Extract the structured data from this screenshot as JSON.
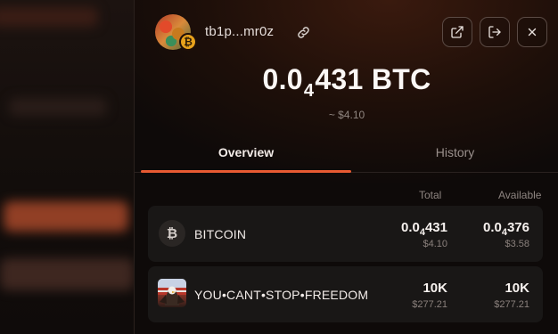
{
  "wallet": {
    "address": "tb1p...mr0z",
    "avatar_badge_symbol": "₿",
    "balance": {
      "prefix": "0.0",
      "subscript_zeros": "4",
      "digits": "431",
      "unit": "BTC",
      "fiat": "~ $4.10"
    }
  },
  "header_actions": {
    "copy_icon": "link-icon",
    "open_external_icon": "external-link-icon",
    "logout_icon": "logout-icon",
    "close_icon": "close-icon"
  },
  "tabs": [
    {
      "label": "Overview",
      "active": true
    },
    {
      "label": "History",
      "active": false
    }
  ],
  "table": {
    "columns": {
      "total": "Total",
      "available": "Available"
    },
    "rows": [
      {
        "name": "BITCOIN",
        "icon": "bitcoin-icon",
        "icon_glyph": "₿",
        "total": {
          "prefix": "0.0",
          "sub": "4",
          "digits": "431",
          "usd": "$4.10"
        },
        "available": {
          "prefix": "0.0",
          "sub": "4",
          "digits": "376",
          "usd": "$3.58"
        }
      },
      {
        "name": "YOU•CANT•STOP•FREEDOM",
        "icon": "freedom-eagle-icon",
        "total": {
          "value": "10K",
          "usd": "$277.21"
        },
        "available": {
          "value": "10K",
          "usd": "$277.21"
        }
      }
    ]
  },
  "colors": {
    "accent": "#e85a32",
    "panel_bg": "#1e0f09",
    "row_bg": "#191716"
  }
}
